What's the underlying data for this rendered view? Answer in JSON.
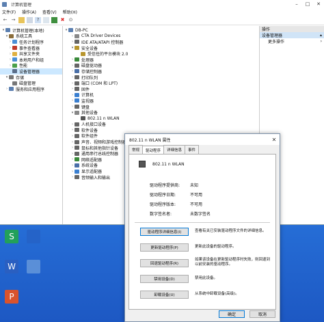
{
  "window": {
    "title": "计算机管理"
  },
  "menu": [
    "文件(F)",
    "操作(A)",
    "查看(V)",
    "帮助(H)"
  ],
  "left_tree": [
    {
      "label": "计算机管理(本地)",
      "level": 0,
      "arrow": "▾",
      "icon": "computer-management-icon",
      "color": "#5b7fb0"
    },
    {
      "label": "系统工具",
      "level": 1,
      "arrow": "▾",
      "icon": "tools-icon",
      "color": "#8a6d3b"
    },
    {
      "label": "任务计划程序",
      "level": 2,
      "arrow": "›",
      "icon": "task-scheduler-icon",
      "color": "#4a8fd6"
    },
    {
      "label": "事件查看器",
      "level": 2,
      "arrow": "›",
      "icon": "event-viewer-icon",
      "color": "#c0392b"
    },
    {
      "label": "共享文件夹",
      "level": 2,
      "arrow": "›",
      "icon": "shared-folder-icon",
      "color": "#e0b040"
    },
    {
      "label": "本地用户和组",
      "level": 2,
      "arrow": "›",
      "icon": "users-icon",
      "color": "#4a8fd6"
    },
    {
      "label": "性能",
      "level": 2,
      "arrow": "›",
      "icon": "performance-icon",
      "color": "#4aa04a"
    },
    {
      "label": "设备管理器",
      "level": 2,
      "arrow": "",
      "icon": "device-manager-icon",
      "color": "#5a6e8a",
      "selected": true
    },
    {
      "label": "存储",
      "level": 1,
      "arrow": "▾",
      "icon": "storage-icon",
      "color": "#777"
    },
    {
      "label": "磁盘管理",
      "level": 2,
      "arrow": "",
      "icon": "disk-icon",
      "color": "#777"
    },
    {
      "label": "服务和应用程序",
      "level": 1,
      "arrow": "›",
      "icon": "services-icon",
      "color": "#5b7fb0"
    }
  ],
  "device_tree": [
    {
      "label": "DB-PC",
      "level": 0,
      "arrow": "▾",
      "color": "#5b7fb0"
    },
    {
      "label": "CTA Driver Devices",
      "level": 1,
      "arrow": "›",
      "color": "#888"
    },
    {
      "label": "IDE ATA/ATAPI 控制器",
      "level": 1,
      "arrow": "›",
      "color": "#666"
    },
    {
      "label": "安全设备",
      "level": 1,
      "arrow": "▾",
      "color": "#b8962e"
    },
    {
      "label": "受信任的平台模块 2.0",
      "level": 2,
      "arrow": "",
      "color": "#b8962e"
    },
    {
      "label": "处理器",
      "level": 1,
      "arrow": "›",
      "color": "#3a8a3a"
    },
    {
      "label": "磁盘驱动器",
      "level": 1,
      "arrow": "›",
      "color": "#666"
    },
    {
      "label": "存储控制器",
      "level": 1,
      "arrow": "›",
      "color": "#4a6fa8"
    },
    {
      "label": "打印队列",
      "level": 1,
      "arrow": "›",
      "color": "#666"
    },
    {
      "label": "端口 (COM 和 LPT)",
      "level": 1,
      "arrow": "›",
      "color": "#666"
    },
    {
      "label": "固件",
      "level": 1,
      "arrow": "›",
      "color": "#666"
    },
    {
      "label": "计算机",
      "level": 1,
      "arrow": "›",
      "color": "#3a7fd0"
    },
    {
      "label": "监视器",
      "level": 1,
      "arrow": "›",
      "color": "#3a7fd0"
    },
    {
      "label": "键盘",
      "level": 1,
      "arrow": "›",
      "color": "#666"
    },
    {
      "label": "其他设备",
      "level": 1,
      "arrow": "▾",
      "color": "#888"
    },
    {
      "label": "802.11 n WLAN",
      "level": 2,
      "arrow": "",
      "color": "#555"
    },
    {
      "label": "人机接口设备",
      "level": 1,
      "arrow": "›",
      "color": "#666"
    },
    {
      "label": "软件设备",
      "level": 1,
      "arrow": "›",
      "color": "#666"
    },
    {
      "label": "软件组件",
      "level": 1,
      "arrow": "›",
      "color": "#666"
    },
    {
      "label": "声音、视频和游戏控制器",
      "level": 1,
      "arrow": "›",
      "color": "#666"
    },
    {
      "label": "鼠标和其他指针设备",
      "level": 1,
      "arrow": "›",
      "color": "#666"
    },
    {
      "label": "通用串行总线控制器",
      "level": 1,
      "arrow": "›",
      "color": "#666"
    },
    {
      "label": "网络适配器",
      "level": 1,
      "arrow": "›",
      "color": "#3a8a3a"
    },
    {
      "label": "系统设备",
      "level": 1,
      "arrow": "›",
      "color": "#4a6fa8"
    },
    {
      "label": "显示适配器",
      "level": 1,
      "arrow": "›",
      "color": "#3a7fd0"
    },
    {
      "label": "音频输入和输出",
      "level": 1,
      "arrow": "›",
      "color": "#666"
    }
  ],
  "actions": {
    "header": "操作",
    "group": "设备管理器",
    "more": "更多操作"
  },
  "desktop_icons": [
    {
      "label": "S",
      "color": "#22a05a"
    },
    {
      "label": "",
      "color": "#2563c8"
    },
    {
      "label": "W",
      "color": "#2a5fc1"
    },
    {
      "label": "",
      "color": "#5a8fd8"
    },
    {
      "label": "P",
      "color": "#d9532c"
    }
  ],
  "dialog": {
    "title": "802.11 n WLAN 属性",
    "tabs": [
      "常规",
      "驱动程序",
      "详细信息",
      "事件"
    ],
    "device_name": "802.11 n WLAN",
    "props": [
      {
        "k": "驱动程序提供商:",
        "v": "未知"
      },
      {
        "k": "驱动程序日期:",
        "v": "不可用"
      },
      {
        "k": "驱动程序版本:",
        "v": "不可用"
      },
      {
        "k": "数字签名者:",
        "v": "未数字签名"
      }
    ],
    "buttons": [
      {
        "label": "驱动程序详细信息(I)",
        "desc": "查看有关已安装驱动程序文件的详细信息。"
      },
      {
        "label": "更新驱动程序(P)",
        "desc": "更新此设备的驱动程序。"
      },
      {
        "label": "回退驱动程序(R)",
        "desc": "如果该设备在更新驱动程序时失败，则回退到以前安装的驱动程序。"
      },
      {
        "label": "禁用设备(D)",
        "desc": "禁用此设备。"
      },
      {
        "label": "卸载设备(U)",
        "desc": "从系统中卸载设备(高级)。"
      }
    ],
    "ok": "确定",
    "cancel": "取消"
  }
}
